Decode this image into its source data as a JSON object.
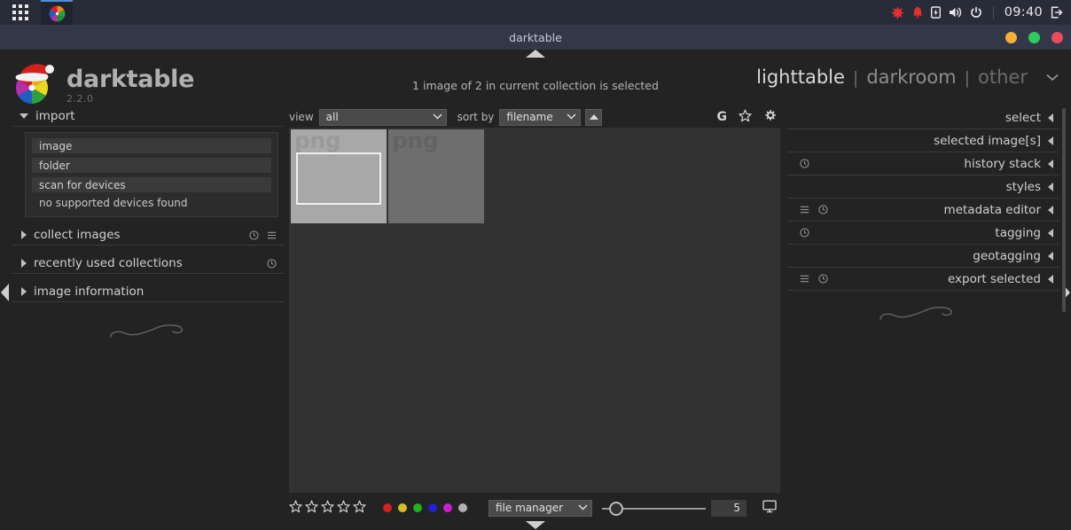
{
  "taskbar": {
    "apps_label": "apps-grid",
    "task_app": "darktable",
    "tray": [
      "notifications-starburst-icon",
      "bell-icon",
      "battery-icon",
      "volume-icon",
      "power-icon"
    ],
    "clock": "09:40",
    "logout_label": "logout-icon"
  },
  "window": {
    "title": "darktable",
    "controls": {
      "minimize_color": "#f2b035",
      "maximize_color": "#2ecc5a",
      "close_color": "#ec4b5a"
    }
  },
  "header": {
    "brand_name": "darktable",
    "version": "2.2.0",
    "status": "1 image of 2 in current collection is selected",
    "views": [
      {
        "label": "lighttable",
        "state": "active"
      },
      {
        "label": "darkroom",
        "state": "inactive"
      },
      {
        "label": "other",
        "state": "dim"
      }
    ],
    "view_separator": "|",
    "chevron": "⌄"
  },
  "left_panel": {
    "modules": [
      {
        "name": "import",
        "label": "import",
        "expanded": true,
        "icons": [],
        "buttons": [
          "image",
          "folder",
          "scan for devices"
        ],
        "note": "no supported devices found"
      },
      {
        "name": "collect-images",
        "label": "collect images",
        "expanded": false,
        "icons": [
          "clock-icon",
          "menu-icon"
        ]
      },
      {
        "name": "recently-used-collections",
        "label": "recently used collections",
        "expanded": false,
        "icons": [
          "clock-icon"
        ]
      },
      {
        "name": "image-information",
        "label": "image information",
        "expanded": false,
        "icons": []
      }
    ]
  },
  "center": {
    "toolbar": {
      "view_label": "view",
      "view_value": "all",
      "sort_label": "sort by",
      "sort_value": "filename",
      "sort_direction": "ascending",
      "icons": [
        {
          "name": "grouping-icon",
          "glyph": "G"
        },
        {
          "name": "overlays-star-icon",
          "glyph": "star"
        },
        {
          "name": "preferences-gear-icon",
          "glyph": "gear"
        }
      ]
    },
    "thumbnails": [
      {
        "ext": "png",
        "selected": true
      },
      {
        "ext": "png",
        "selected": false
      }
    ],
    "bottom": {
      "star_count": 5,
      "color_labels": [
        "#d42020",
        "#d4c020",
        "#20b020",
        "#2020d4",
        "#cc20cc",
        "#b0b0b0"
      ],
      "layout_value": "file manager",
      "zoom_value": "5",
      "display_icon": "monitor-icon"
    }
  },
  "right_panel": {
    "modules": [
      {
        "name": "select",
        "label": "select",
        "icons": []
      },
      {
        "name": "selected-images",
        "label": "selected image[s]",
        "icons": []
      },
      {
        "name": "history-stack",
        "label": "history stack",
        "icons": [
          "clock-icon"
        ]
      },
      {
        "name": "styles",
        "label": "styles",
        "icons": []
      },
      {
        "name": "metadata-editor",
        "label": "metadata editor",
        "icons": [
          "menu-icon",
          "clock-icon"
        ]
      },
      {
        "name": "tagging",
        "label": "tagging",
        "icons": [
          "clock-icon"
        ]
      },
      {
        "name": "geotagging",
        "label": "geotagging",
        "icons": []
      },
      {
        "name": "export-selected",
        "label": "export selected",
        "icons": [
          "menu-icon",
          "clock-icon"
        ]
      }
    ]
  }
}
